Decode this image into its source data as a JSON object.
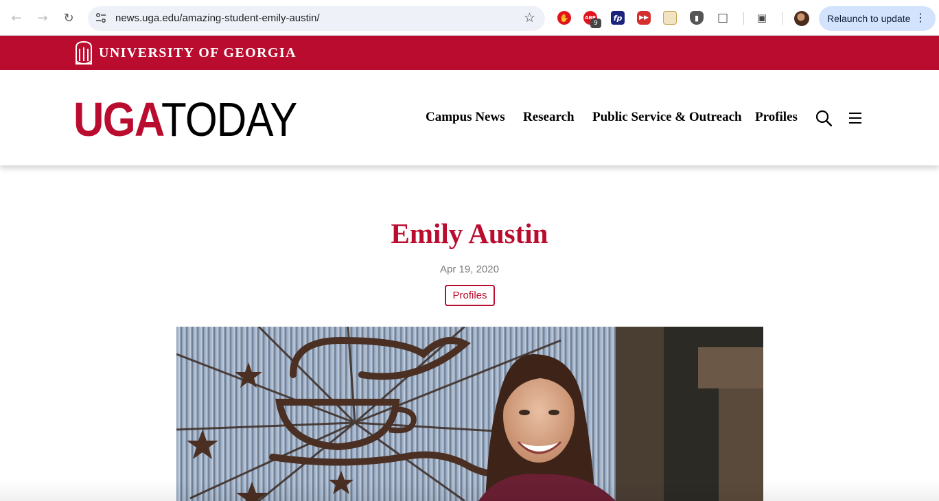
{
  "browser": {
    "url": "news.uga.edu/amazing-student-emily-austin/",
    "extension_badge": "9",
    "relaunch_label": "Relaunch to update"
  },
  "brand_bar": {
    "university_name": "UNIVERSITY OF GEORGIA"
  },
  "site_header": {
    "logo_uga": "UGA",
    "logo_today": "TODAY",
    "menu": [
      {
        "label": "Campus News"
      },
      {
        "label": "Research"
      },
      {
        "label": "Public Service & Outreach"
      },
      {
        "label": "Profiles"
      }
    ]
  },
  "article": {
    "title": "Emily Austin",
    "date": "Apr 19, 2020",
    "category_tag": "Profiles"
  },
  "colors": {
    "uga_red": "#ba0c2f",
    "relaunch_bg": "#d3e3fd",
    "omnibox_bg": "#eef2f8"
  }
}
